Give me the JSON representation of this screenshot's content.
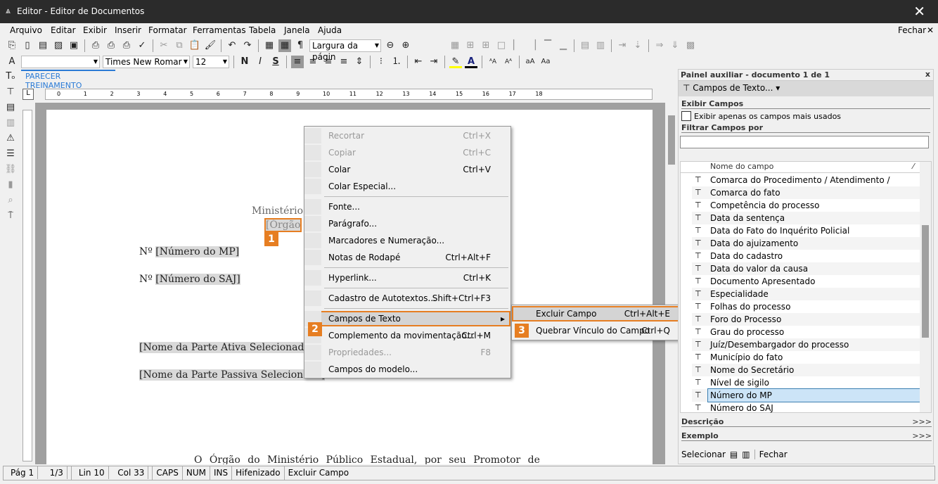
{
  "window": {
    "title": "Editor - Editor de Documentos"
  },
  "menu": [
    "Arquivo",
    "Editar",
    "Exibir",
    "Inserir",
    "Formatar",
    "Ferramentas",
    "Tabela",
    "Janela",
    "Ajuda"
  ],
  "menu_close": "Fechar",
  "toolbar": {
    "zoom_mode": "Largura da págin",
    "font": "Times New Romar",
    "size": "12",
    "style": "",
    "bold": "N",
    "italic": "I",
    "strike": "S"
  },
  "tab": "PARECER TREINAMENTO",
  "document": {
    "ministerio": "Ministério",
    "orgao": "[Órgão",
    "num_mp_prefix": "Nº ",
    "num_mp": "[Número do MP]",
    "num_saj_prefix": "Nº ",
    "num_saj": "[Número do SAJ]",
    "parte_ativa": "[Nome da Parte Ativa Selecionada",
    "parte_passiva": "[Nome da Parte Passiva Selecionada]",
    "body": "O Órgão do Ministério Público Estadual, por seu Promotor de"
  },
  "context_menu": [
    {
      "label": "Recortar",
      "shortcut": "Ctrl+X",
      "disabled": true
    },
    {
      "label": "Copiar",
      "shortcut": "Ctrl+C",
      "disabled": true
    },
    {
      "label": "Colar",
      "shortcut": "Ctrl+V"
    },
    {
      "label": "Colar Especial..."
    },
    {
      "label": "Fonte..."
    },
    {
      "label": "Parágrafo..."
    },
    {
      "label": "Marcadores e Numeração..."
    },
    {
      "label": "Notas de Rodapé",
      "shortcut": "Ctrl+Alt+F"
    },
    {
      "label": "Hyperlink...",
      "shortcut": "Ctrl+K"
    },
    {
      "label": "Cadastro de Autotextos...",
      "shortcut": "Shift+Ctrl+F3"
    },
    {
      "label": "Campos de Texto",
      "submenu": true
    },
    {
      "label": "Complemento da movimentação...",
      "shortcut": "Ctrl+M"
    },
    {
      "label": "Propriedades...",
      "shortcut": "F8",
      "disabled": true
    },
    {
      "label": "Campos do modelo..."
    }
  ],
  "submenu": [
    {
      "label": "Excluir Campo",
      "shortcut": "Ctrl+Alt+E"
    },
    {
      "label": "Quebrar Vínculo do Campo",
      "shortcut": "Ctrl+Q"
    }
  ],
  "badges": [
    "1",
    "2",
    "3"
  ],
  "panel": {
    "title": "Painel auxiliar - documento 1 de 1",
    "close": "x",
    "dropdown": "Campos de Texto...",
    "exibir_header": "Exibir Campos",
    "checkbox_label": "Exibir apenas os campos mais usados",
    "filter_header": "Filtrar Campos por",
    "filter_value": "",
    "column": "Nome do campo",
    "fields": [
      "Comarca do Procedimento / Atendimento / Protocolo",
      "Comarca do fato",
      "Competência do processo",
      "Data da sentença",
      "Data do Fato do Inquérito Policial",
      "Data do ajuizamento",
      "Data do cadastro",
      "Data do valor da causa",
      "Documento Apresentado",
      "Especialidade",
      "Folhas do processo",
      "Foro do Processo",
      "Grau do processo",
      "Juíz/Desembargador do processo",
      "Município do fato",
      "Nome do Secretário",
      "Nível de sigilo",
      "Número do MP",
      "Número do SAJ"
    ],
    "selected": "Número do MP",
    "descricao": "Descrição",
    "exemplo": "Exemplo",
    "more": ">>>",
    "selecionar": "Selecionar",
    "fechar": "Fechar"
  },
  "status": [
    "Pág 1",
    "1/3",
    "Lin 10",
    "Col 33",
    "CAPS",
    "NUM",
    "INS",
    "Hifenizado",
    "Excluir Campo"
  ],
  "colors": {
    "accent": "#e67e22",
    "titlebar": "#2b2b2b",
    "selection": "#cce4f7"
  }
}
